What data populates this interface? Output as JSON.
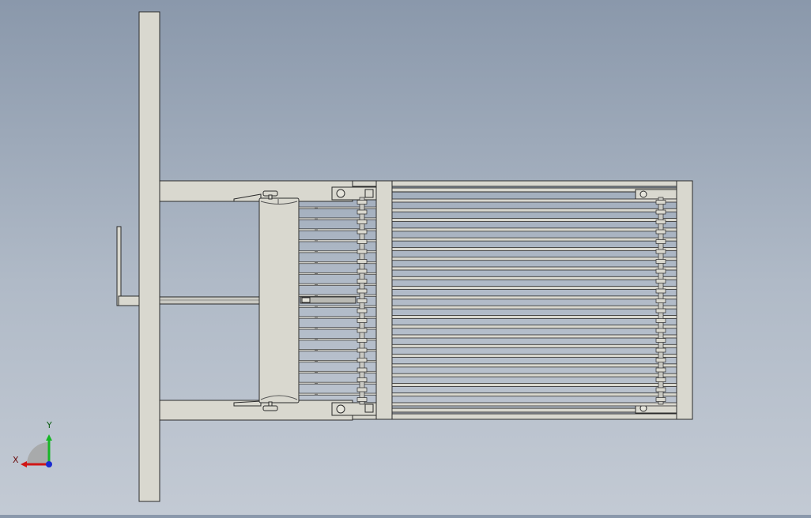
{
  "triad": {
    "x_label": "X",
    "y_label": "Y"
  },
  "colors": {
    "part_fill": "#d9d8cf",
    "part_stroke": "#2b2b2b",
    "rod_fill": "#c9c9c3",
    "axis_x": "#d01616",
    "axis_y": "#17b626",
    "axis_z": "#1b2bd0"
  },
  "counts": {
    "bars": 22,
    "fingers": 18,
    "rollers_rear": 21,
    "rollers_front": 21
  }
}
